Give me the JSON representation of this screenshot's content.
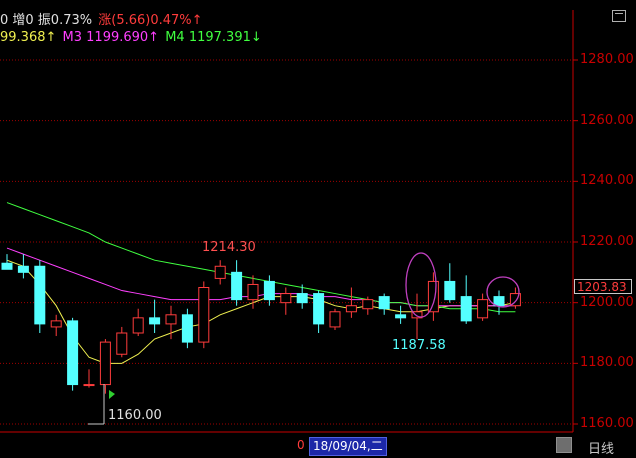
{
  "header": {
    "line1": [
      {
        "text": "0 增0 振0.73%",
        "color": "#e0e0e0"
      },
      {
        "text": "涨(5.66)0.47%↑",
        "color": "#ff3c3c"
      }
    ],
    "line2": [
      {
        "text": "99.368↑",
        "color": "#f0f050"
      },
      {
        "text": "M3 1199.690↑",
        "color": "#ff40ff"
      },
      {
        "text": "M4 1197.391↓",
        "color": "#40ff40"
      }
    ]
  },
  "price_axis": {
    "labels": [
      "1280.00",
      "1260.00",
      "1240.00",
      "1220.00",
      "1200.00",
      "1180.00",
      "1160.00"
    ],
    "values": [
      1280,
      1260,
      1240,
      1220,
      1200,
      1180,
      1160
    ],
    "last_price": "1203.83"
  },
  "annotations": {
    "high": "1214.30",
    "low": "1160.00",
    "mid_low": "1187.58"
  },
  "footer": {
    "zero": "0",
    "date": "18/09/04,二",
    "period": "日线"
  },
  "colors": {
    "up": "#ff3c3c",
    "down": "#54ffff",
    "grid": "#a00000",
    "axis": "#c80000"
  },
  "chart_data": {
    "type": "candlestick",
    "ylim": [
      1155,
      1292
    ],
    "candles": [
      {
        "o": 1213,
        "h": 1216,
        "l": 1211,
        "c": 1211
      },
      {
        "o": 1212,
        "h": 1216,
        "l": 1208,
        "c": 1210
      },
      {
        "o": 1212,
        "h": 1214,
        "l": 1190,
        "c": 1193
      },
      {
        "o": 1192,
        "h": 1196,
        "l": 1189,
        "c": 1194
      },
      {
        "o": 1194,
        "h": 1195,
        "l": 1171,
        "c": 1173
      },
      {
        "o": 1173,
        "h": 1178,
        "l": 1172,
        "c": 1173
      },
      {
        "o": 1173,
        "h": 1188,
        "l": 1170,
        "c": 1187
      },
      {
        "o": 1183,
        "h": 1192,
        "l": 1182,
        "c": 1190
      },
      {
        "o": 1190,
        "h": 1198,
        "l": 1189,
        "c": 1195
      },
      {
        "o": 1195,
        "h": 1201,
        "l": 1190,
        "c": 1193
      },
      {
        "o": 1193,
        "h": 1199,
        "l": 1188,
        "c": 1196
      },
      {
        "o": 1196,
        "h": 1198,
        "l": 1185,
        "c": 1187
      },
      {
        "o": 1187,
        "h": 1207,
        "l": 1185,
        "c": 1205
      },
      {
        "o": 1208,
        "h": 1214,
        "l": 1206,
        "c": 1212
      },
      {
        "o": 1210,
        "h": 1214,
        "l": 1199,
        "c": 1201
      },
      {
        "o": 1201,
        "h": 1209,
        "l": 1198,
        "c": 1206
      },
      {
        "o": 1207,
        "h": 1209,
        "l": 1199,
        "c": 1201
      },
      {
        "o": 1200,
        "h": 1205,
        "l": 1196,
        "c": 1203
      },
      {
        "o": 1203,
        "h": 1206,
        "l": 1198,
        "c": 1200
      },
      {
        "o": 1203,
        "h": 1204,
        "l": 1190,
        "c": 1193
      },
      {
        "o": 1192,
        "h": 1198,
        "l": 1191,
        "c": 1197
      },
      {
        "o": 1197,
        "h": 1205,
        "l": 1195,
        "c": 1199
      },
      {
        "o": 1198,
        "h": 1202,
        "l": 1196,
        "c": 1201
      },
      {
        "o": 1202,
        "h": 1203,
        "l": 1196,
        "c": 1198
      },
      {
        "o": 1196,
        "h": 1199,
        "l": 1193,
        "c": 1195
      },
      {
        "o": 1195,
        "h": 1203,
        "l": 1188,
        "c": 1197
      },
      {
        "o": 1197,
        "h": 1210,
        "l": 1194,
        "c": 1207
      },
      {
        "o": 1207,
        "h": 1213,
        "l": 1200,
        "c": 1201
      },
      {
        "o": 1202,
        "h": 1209,
        "l": 1193,
        "c": 1194
      },
      {
        "o": 1195,
        "h": 1203,
        "l": 1194,
        "c": 1201
      },
      {
        "o": 1202,
        "h": 1204,
        "l": 1196,
        "c": 1199
      },
      {
        "o": 1199,
        "h": 1205,
        "l": 1198,
        "c": 1203
      }
    ],
    "ma_series": [
      {
        "color": "#f0f050",
        "values": [
          1214,
          1212,
          1206,
          1199,
          1189,
          1182,
          1180,
          1180,
          1183,
          1188,
          1190,
          1192,
          1193,
          1196,
          1198,
          1200,
          1202,
          1202,
          1202,
          1201,
          1199,
          1198,
          1199,
          1198,
          1197,
          1197,
          1198,
          1199,
          1199,
          1199,
          1199,
          1200
        ]
      },
      {
        "color": "#ff40ff",
        "values": [
          1218,
          1216,
          1214,
          1212,
          1210,
          1208,
          1206,
          1204,
          1203,
          1202,
          1201,
          1201,
          1201,
          1201,
          1202,
          1202,
          1203,
          1203,
          1203,
          1202,
          1202,
          1201,
          1201,
          1200,
          1200,
          1199,
          1199,
          1199,
          1199,
          1199,
          1199,
          1199
        ]
      },
      {
        "color": "#40ff40",
        "values": [
          1233,
          1231,
          1229,
          1227,
          1225,
          1223,
          1220,
          1218,
          1216,
          1214,
          1213,
          1212,
          1211,
          1210,
          1209,
          1208,
          1207,
          1206,
          1205,
          1204,
          1203,
          1202,
          1201,
          1200,
          1200,
          1199,
          1199,
          1198,
          1198,
          1198,
          1197,
          1197
        ]
      }
    ]
  }
}
